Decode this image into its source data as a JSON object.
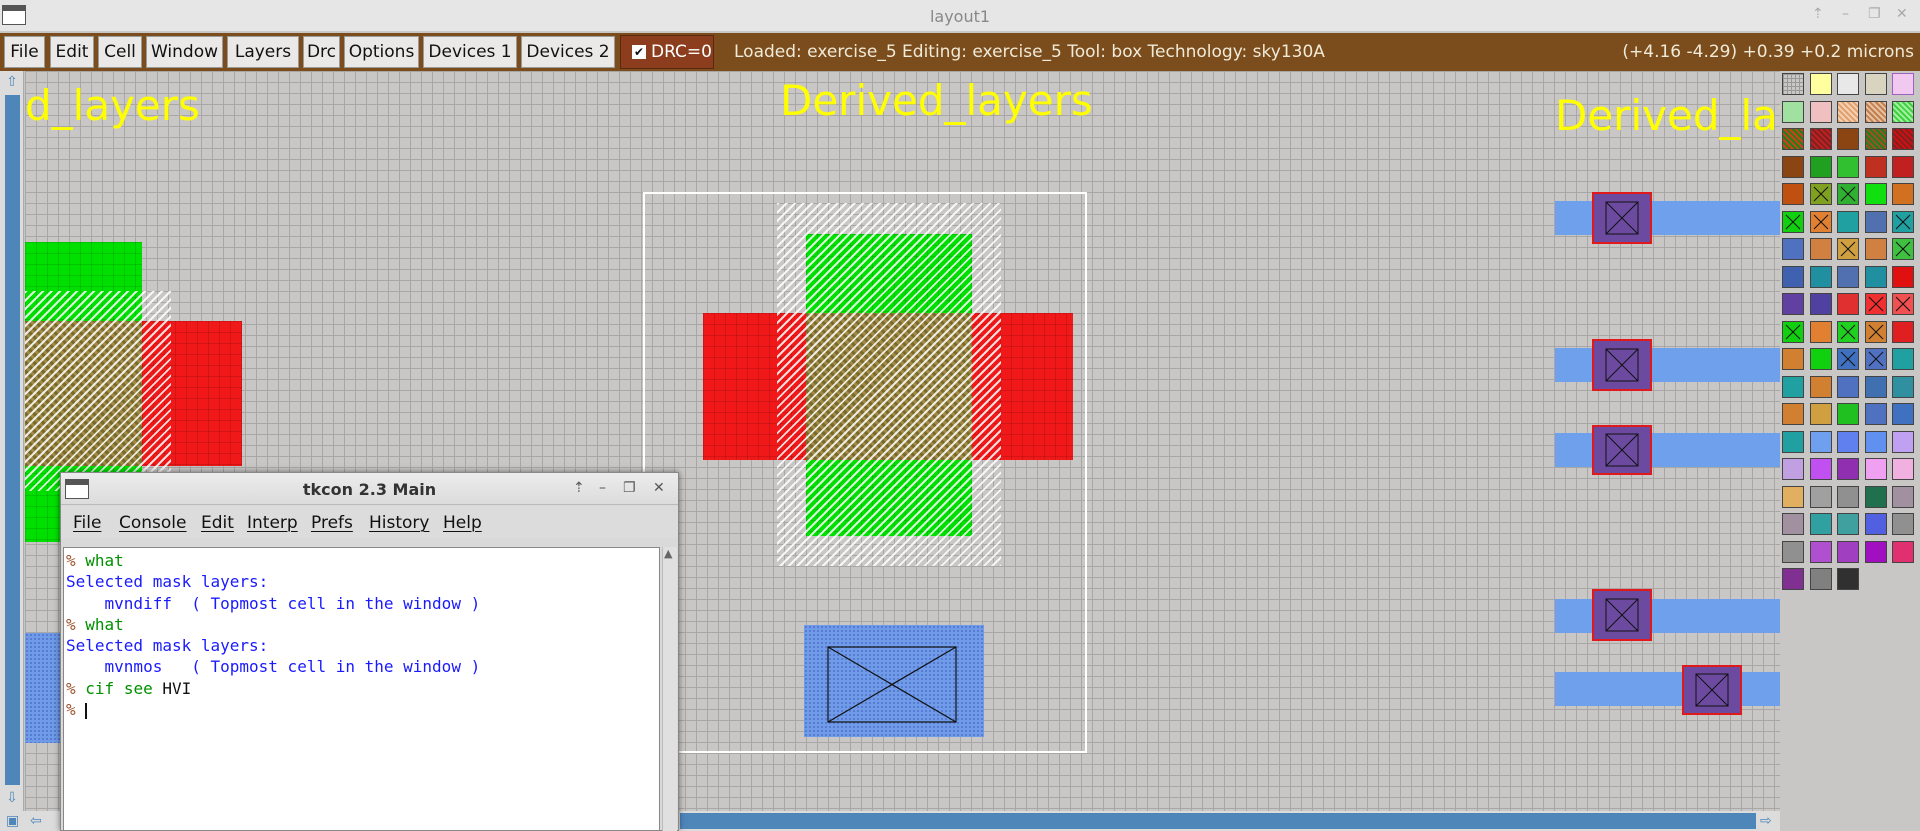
{
  "window": {
    "title": "layout1"
  },
  "menubar": {
    "buttons": [
      "File",
      "Edit",
      "Cell",
      "Window",
      "Layers",
      "Drc",
      "Options",
      "Devices 1",
      "Devices 2"
    ],
    "drc_label": "DRC=0",
    "status": "Loaded: exercise_5 Editing: exercise_5 Tool: box  Technology: sky130A",
    "coords": "(+4.16 -4.29) +0.39 +0.2 microns"
  },
  "canvas": {
    "labels": [
      "d_layers",
      "Derived_layers",
      "Derived_lay"
    ]
  },
  "tkcon": {
    "title": "tkcon 2.3 Main",
    "menu": [
      "File",
      "Console",
      "Edit",
      "Interp",
      "Prefs",
      "History",
      "Help"
    ],
    "prompt": "%",
    "lines": [
      {
        "type": "cmd",
        "text": "what"
      },
      {
        "type": "out",
        "text": "Selected mask layers:"
      },
      {
        "type": "out",
        "text": "    mvndiff  ( Topmost cell in the window )"
      },
      {
        "type": "cmd",
        "text": "what"
      },
      {
        "type": "out",
        "text": "Selected mask layers:"
      },
      {
        "type": "out",
        "text": "    mvnmos   ( Topmost cell in the window )"
      },
      {
        "type": "cmd2",
        "cmd": "cif see",
        "arg": "HVI"
      }
    ]
  },
  "colors": {
    "accent": "#7b4d1c",
    "drc": "#8b3d1e",
    "poly": "#f01818",
    "diff": "#00e000",
    "metal": "#6ea0ec",
    "label": "#ffff00"
  }
}
